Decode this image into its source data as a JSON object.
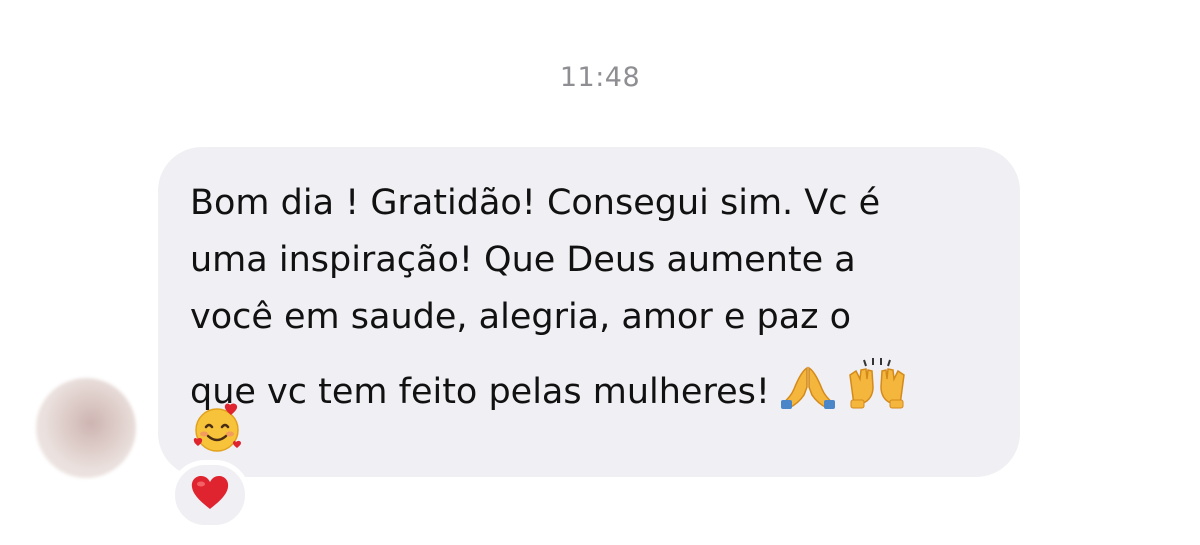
{
  "chat": {
    "timestamp": "11:48",
    "message": {
      "lines": [
        "Bom dia ! Gratidão! Consegui sim. Vc é",
        "uma inspiração! Que Deus aumente a",
        "você em saude, alegria, amor e paz o",
        "que vc tem feito pelas mulheres!"
      ],
      "emojis": [
        "folded-hands-icon",
        "raising-hands-icon",
        "smiling-face-with-hearts-icon"
      ]
    },
    "reaction": "heart-icon"
  },
  "colors": {
    "bubble": "#efeff4",
    "timestamp": "#8e8e93",
    "text": "#111111",
    "heart": "#e0242f"
  }
}
